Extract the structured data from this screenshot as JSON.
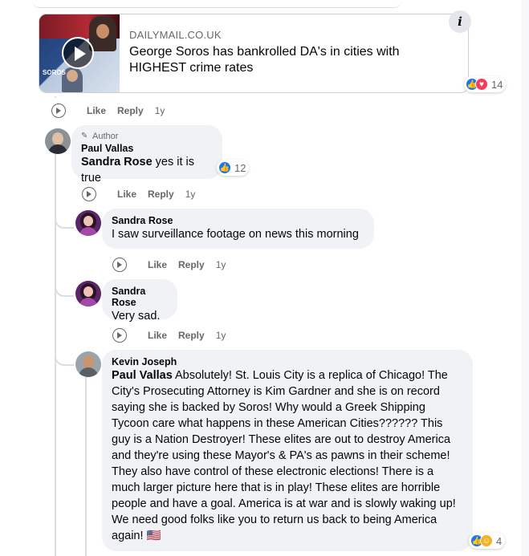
{
  "link_preview": {
    "domain": "DAILYMAIL.CO.UK",
    "title": "George Soros has bankrolled DA's in cities with HIGHEST crime rates",
    "thumbnail_text": "SOROS",
    "reaction_count": "14",
    "info_label": "i"
  },
  "actions": {
    "like": "Like",
    "reply": "Reply",
    "time": "1y"
  },
  "comments": [
    {
      "badge": "Author",
      "name": "Paul Vallas",
      "mention": "Sandra Rose",
      "text": " yes it is true",
      "reaction_count": "12"
    },
    {
      "name": "Sandra Rose",
      "text": "I saw surveillance footage on news this morning"
    },
    {
      "name": "Sandra Rose",
      "text": "Very sad."
    },
    {
      "name": "Kevin Joseph",
      "mention": "Paul Vallas",
      "text": " Absolutely! St. Louis City is a replica of Chicago! The City's Prosecuting Attorney is Kim Gardner and she is on record saying she is backed by Soros! Why would a Greek Shipping Tycoon care what happens in these American Cities?????? This guy is a Nation Destroyer! These elites are out to destroy America and they're using these Mayor's & PA's as pawns in their scheme! They also have control of these electronic elections! There is a much larger picture here that is in play! These elites are horrible people and have a goal. America is at war and is slowly waking up! We need good folks like you to return us back to being America again! 🇺🇸",
      "reaction_count": "4"
    }
  ],
  "colors": {
    "bubble": "#f0f2f5",
    "secondary_text": "#65676b",
    "like_blue": "#1877f2",
    "love_red": "#f33e58"
  }
}
